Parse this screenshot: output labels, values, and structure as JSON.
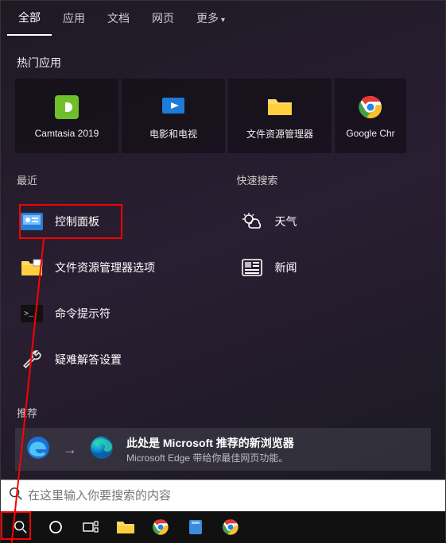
{
  "tabs": {
    "all": "全部",
    "apps": "应用",
    "docs": "文档",
    "web": "网页",
    "more": "更多"
  },
  "sections": {
    "hot_apps": "热门应用",
    "recent": "最近",
    "quick_search": "快速搜索",
    "recommend": "推荐"
  },
  "hot_apps": {
    "camtasia": "Camtasia 2019",
    "movies": "电影和电视",
    "explorer": "文件资源管理器",
    "chrome": "Google Chr"
  },
  "recent": {
    "control_panel": "控制面板",
    "explorer_options": "文件资源管理器选项",
    "cmd": "命令提示符",
    "troubleshoot": "疑难解答设置"
  },
  "quick": {
    "weather": "天气",
    "news": "新闻"
  },
  "edge": {
    "title": "此处是 Microsoft 推荐的新浏览器",
    "sub": "Microsoft Edge 带给你最佳网页功能。"
  },
  "search": {
    "placeholder": "在这里输入你要搜索的内容"
  },
  "icons": {
    "search": "search-icon",
    "cortana": "cortana-icon",
    "taskview": "taskview-icon"
  }
}
